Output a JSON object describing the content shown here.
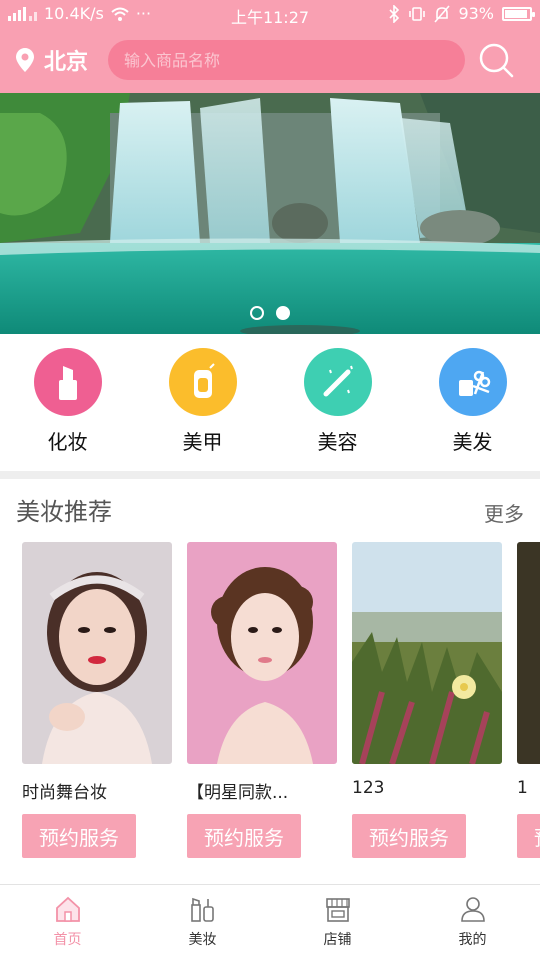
{
  "status_bar": {
    "network_speed": "10.4K/s",
    "more": "···",
    "time": "上午11:27",
    "battery_percent": "93%",
    "battery_level": 0.93
  },
  "header": {
    "city": "北京",
    "search_placeholder": "输入商品名称"
  },
  "banner": {
    "slides": 2,
    "active_slide": 2
  },
  "categories": [
    {
      "label": "化妆",
      "icon": "lipstick-icon",
      "color": "#ef5f92"
    },
    {
      "label": "美甲",
      "icon": "nail-polish-icon",
      "color": "#fbbd2c"
    },
    {
      "label": "美容",
      "icon": "magic-wand-icon",
      "color": "#3ecfb2"
    },
    {
      "label": "美发",
      "icon": "scissors-icon",
      "color": "#4ea7f2"
    }
  ],
  "recommend": {
    "title": "美妆推荐",
    "more": "更多",
    "items": [
      {
        "name": "时尚舞台妆",
        "button": "预约服务"
      },
      {
        "name": "【明星同款...",
        "button": "预约服务"
      },
      {
        "name": "123",
        "button": "预约服务"
      },
      {
        "name": "1",
        "button": "预约服务"
      }
    ]
  },
  "bottom_nav": [
    {
      "label": "首页",
      "icon": "home-icon",
      "active": true
    },
    {
      "label": "美妆",
      "icon": "makeup-icon",
      "active": false
    },
    {
      "label": "店铺",
      "icon": "store-icon",
      "active": false
    },
    {
      "label": "我的",
      "icon": "user-icon",
      "active": false
    }
  ],
  "colors": {
    "brand": "#f9a0b2",
    "search_bg": "#f67f98",
    "active_nav": "#f392a8"
  }
}
